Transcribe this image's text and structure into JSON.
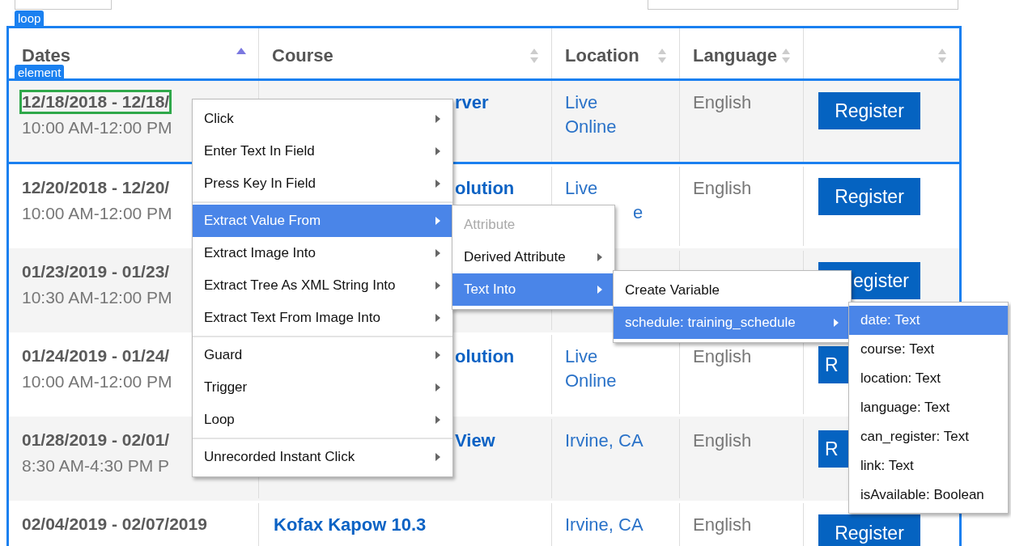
{
  "tags": {
    "loop": "loop",
    "element": "element"
  },
  "columns": [
    {
      "label": "Dates",
      "sorted": true
    },
    {
      "label": "Course",
      "sorted": false
    },
    {
      "label": "Location",
      "sorted": false
    },
    {
      "label": "Language",
      "sorted": false
    },
    {
      "sorted": false
    }
  ],
  "rows": [
    {
      "selected": true,
      "outlined": true,
      "dates": "12/18/2018 - 12/18/",
      "time": "10:00 AM-12:00 PM",
      "course": {
        "text": "rver",
        "clipped": true
      },
      "location": [
        {
          "text": "Live",
          "clipped": false
        },
        {
          "text": "Online",
          "clipped": false
        }
      ],
      "language": "English",
      "button": {
        "label": "Register",
        "clipped": false
      }
    },
    {
      "selected": false,
      "outlined": false,
      "dates": "12/20/2018 - 12/20/",
      "time": "10:00 AM-12:00 PM",
      "course": {
        "text": "olution",
        "clipped": true
      },
      "location": [
        {
          "text": "Live",
          "clipped": false
        },
        {
          "text": "e",
          "clipped": true
        }
      ],
      "language": "English",
      "button": {
        "label": "Register",
        "clipped": false
      }
    },
    {
      "selected": false,
      "outlined": false,
      "dates": "01/23/2019 - 01/23/",
      "time": "10:30 AM-12:00 PM",
      "location": [],
      "button": {
        "label": "egister",
        "clipped": true,
        "label_start": false
      }
    },
    {
      "selected": false,
      "outlined": false,
      "dates": "01/24/2019 - 01/24/",
      "time": "10:00 AM-12:00 PM",
      "course": {
        "text": "olution",
        "clipped": true
      },
      "location": [
        {
          "text": "Live",
          "clipped": false
        },
        {
          "text": "Online",
          "clipped": false
        }
      ],
      "language": "English",
      "button": {
        "label": "R",
        "clipped": true,
        "label_start": true
      }
    },
    {
      "selected": false,
      "outlined": false,
      "dates": "01/28/2019 - 02/01/",
      "time": "8:30 AM-4:30 PM P",
      "course": {
        "text": "View",
        "clipped": true
      },
      "location": [
        {
          "text": "Irvine, CA",
          "clipped": false
        }
      ],
      "language": "English",
      "button": {
        "label": "R",
        "clipped": true,
        "label_start": true
      }
    },
    {
      "selected": false,
      "outlined": false,
      "dates": "02/04/2019 - 02/07/2019",
      "course": {
        "text": "Kofax Kapow 10.3",
        "clipped": false
      },
      "location": [
        {
          "text": "Irvine, CA",
          "clipped": false
        }
      ],
      "language": "English",
      "button": {
        "label": "Register",
        "clipped": false
      }
    }
  ],
  "menus": [
    {
      "items": [
        {
          "kind": "item",
          "label": "Click",
          "submenu": true,
          "selected": false,
          "disabled": false
        },
        {
          "kind": "item",
          "label": "Enter Text In Field",
          "submenu": true,
          "selected": false,
          "disabled": false
        },
        {
          "kind": "item",
          "label": "Press Key In Field",
          "submenu": true,
          "selected": false,
          "disabled": false
        },
        {
          "kind": "separator"
        },
        {
          "kind": "item",
          "label": "Extract Value From",
          "submenu": true,
          "selected": true,
          "disabled": false
        },
        {
          "kind": "item",
          "label": "Extract Image Into",
          "submenu": true,
          "selected": false,
          "disabled": false
        },
        {
          "kind": "item",
          "label": "Extract Tree As XML String Into",
          "submenu": true,
          "selected": false,
          "disabled": false
        },
        {
          "kind": "item",
          "label": "Extract Text From Image Into",
          "submenu": true,
          "selected": false,
          "disabled": false
        },
        {
          "kind": "separator"
        },
        {
          "kind": "item",
          "label": "Guard",
          "submenu": true,
          "selected": false,
          "disabled": false
        },
        {
          "kind": "item",
          "label": "Trigger",
          "submenu": true,
          "selected": false,
          "disabled": false
        },
        {
          "kind": "item",
          "label": "Loop",
          "submenu": true,
          "selected": false,
          "disabled": false
        },
        {
          "kind": "separator"
        },
        {
          "kind": "item",
          "label": "Unrecorded Instant Click",
          "submenu": true,
          "selected": false,
          "disabled": false
        }
      ]
    },
    {
      "items": [
        {
          "kind": "item",
          "label": "Attribute",
          "submenu": false,
          "selected": false,
          "disabled": true
        },
        {
          "kind": "item",
          "label": "Derived Attribute",
          "submenu": true,
          "selected": false,
          "disabled": false
        },
        {
          "kind": "item",
          "label": "Text Into",
          "submenu": true,
          "selected": true,
          "disabled": false
        }
      ]
    },
    {
      "items": [
        {
          "kind": "item",
          "label": "Create Variable",
          "submenu": false,
          "selected": false,
          "disabled": false
        },
        {
          "kind": "item",
          "label": "schedule: training_schedule",
          "submenu": true,
          "selected": true,
          "disabled": false
        }
      ]
    },
    {
      "items": [
        {
          "kind": "item",
          "label": "date: Text",
          "submenu": false,
          "selected": true,
          "disabled": false
        },
        {
          "kind": "item",
          "label": "course: Text",
          "submenu": false,
          "selected": false,
          "disabled": false
        },
        {
          "kind": "item",
          "label": "location: Text",
          "submenu": false,
          "selected": false,
          "disabled": false
        },
        {
          "kind": "item",
          "label": "language: Text",
          "submenu": false,
          "selected": false,
          "disabled": false
        },
        {
          "kind": "item",
          "label": "can_register: Text",
          "submenu": false,
          "selected": false,
          "disabled": false
        },
        {
          "kind": "item",
          "label": "link: Text",
          "submenu": false,
          "selected": false,
          "disabled": false
        },
        {
          "kind": "item",
          "label": "isAvailable: Boolean",
          "submenu": false,
          "selected": false,
          "disabled": false
        }
      ]
    }
  ]
}
